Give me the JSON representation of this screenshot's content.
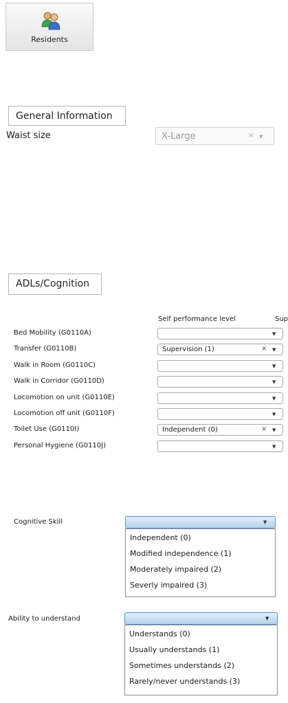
{
  "toolbar": {
    "residents_label": "Residents"
  },
  "general": {
    "tab_label": "General Information",
    "waist_label": "Waist size",
    "waist_value": "X-Large"
  },
  "adl": {
    "tab_label": "ADLs/Cognition",
    "col_self": "Self performance level",
    "col_sup": "Sup",
    "rows": [
      {
        "label": "Bed Mobility (G0110A)",
        "value": ""
      },
      {
        "label": "Transfer (G0110B)",
        "value": "Supervision (1)"
      },
      {
        "label": "Walk in Room (G0110C)",
        "value": ""
      },
      {
        "label": "Walk in Corridor (G0110D)",
        "value": ""
      },
      {
        "label": "Locomotion on unit (G0110E)",
        "value": ""
      },
      {
        "label": "Locomotion off unit (G0110F)",
        "value": ""
      },
      {
        "label": "Toilet Use (G0110I)",
        "value": "Independent (0)"
      },
      {
        "label": "Personal Hygiene (G0110J)",
        "value": ""
      }
    ]
  },
  "cognitive": {
    "label": "Cognitive Skill",
    "options": [
      "Independent (0)",
      "Modified independence (1)",
      "Moderately impaired (2)",
      "Severly impaired (3)"
    ]
  },
  "understand": {
    "label": "Ability to understand",
    "options": [
      "Understands (0)",
      "Usually understands (1)",
      "Sometimes understands (2)",
      "Rarely/never understands (3)"
    ]
  },
  "icons": {
    "clear": "×",
    "dropdown": "▼"
  },
  "colors": {
    "active_combo_top": "#e2eefa",
    "active_combo_bottom": "#b7d1ec",
    "active_border": "#5b90c8"
  }
}
